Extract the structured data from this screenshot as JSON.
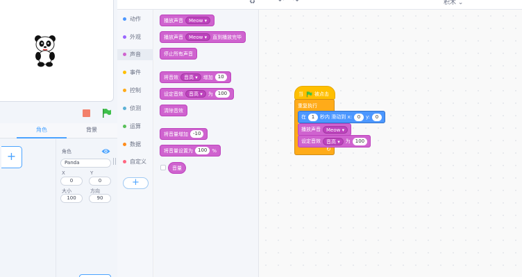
{
  "topbar": {
    "workspace_label": "积木 ⌄",
    "undo_icon": "↶",
    "redo_icon": "↷",
    "sprite_icon": "♻"
  },
  "stage": {
    "sprite_name": "Panda",
    "tabs": {
      "role": "角色",
      "backdrop": "背景"
    },
    "add_sprite": "+",
    "props": {
      "role_label": "角色",
      "role_value": "Panda",
      "x_label": "X",
      "x_value": "0",
      "y_label": "Y",
      "y_value": "0",
      "size_label": "大小",
      "size_value": "100",
      "dir_label": "方向",
      "dir_value": "90"
    },
    "colors": {
      "stop": "#f3806b",
      "flag": "#3ec04a",
      "accent": "#4aa3ff"
    }
  },
  "categories": [
    {
      "label": "动作",
      "color": "#4c97ff"
    },
    {
      "label": "外观",
      "color": "#9966ff"
    },
    {
      "label": "声音",
      "color": "#cf63cf"
    },
    {
      "label": "事件",
      "color": "#ffbf00"
    },
    {
      "label": "控制",
      "color": "#ffab19"
    },
    {
      "label": "侦测",
      "color": "#5cb1d6"
    },
    {
      "label": "运算",
      "color": "#59c059"
    },
    {
      "label": "数据",
      "color": "#ff8c1a"
    },
    {
      "label": "自定义",
      "color": "#ff6680"
    }
  ],
  "add_extension": "+",
  "palette": {
    "play_sound": "播放声音",
    "sound_name": "Meow",
    "play_until_done_a": "播放声音",
    "play_until_done_b": "直到播放完毕",
    "stop_all": "停止所有声音",
    "change_effect_a": "将音效",
    "effect_name": "音高",
    "change_effect_b": "增加",
    "change_effect_val": "10",
    "set_effect_a": "设定音效",
    "set_effect_b": "为",
    "set_effect_val": "100",
    "clear_effects": "清除音效",
    "change_volume_a": "将音量增加",
    "change_volume_val": "-10",
    "set_volume_a": "将音量设置为",
    "set_volume_val": "100",
    "set_volume_unit": "%",
    "volume_reporter": "音量"
  },
  "script": {
    "when_flag_a": "当",
    "when_flag_b": "被点击",
    "forever": "重复执行",
    "glide_a": "在",
    "glide_secs": "1",
    "glide_b": "秒内 滑动到 x:",
    "glide_x": "0",
    "glide_y_label": "y:",
    "glide_y": "0",
    "play_sound": "播放声音",
    "sound_name": "Meow",
    "set_effect_a": "设定音效",
    "effect_name": "音高",
    "set_effect_b": "为",
    "set_effect_val": "100",
    "loop_arrow": "↻"
  }
}
